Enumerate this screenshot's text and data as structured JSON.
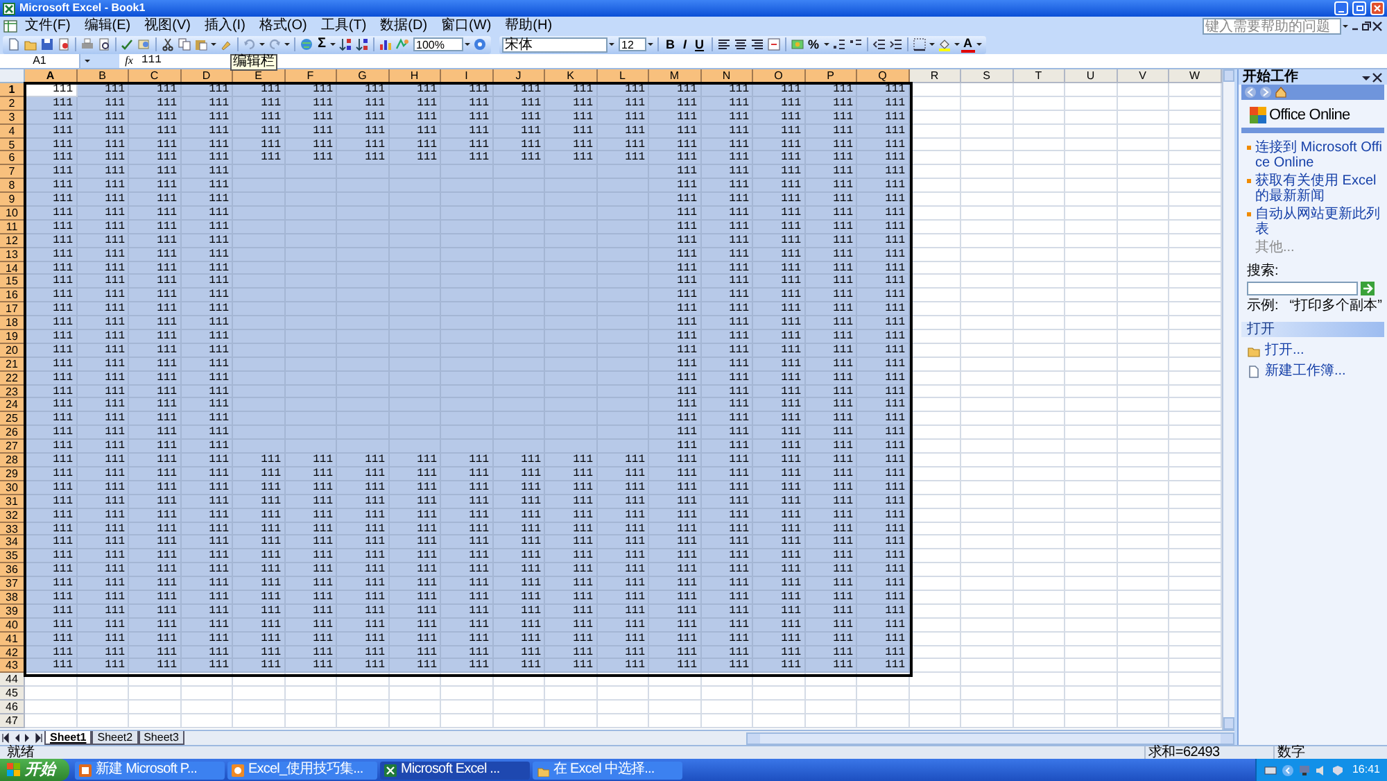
{
  "window": {
    "title": "Microsoft Excel - Book1"
  },
  "menu_bar": {
    "items": [
      "文件(F)",
      "编辑(E)",
      "视图(V)",
      "插入(I)",
      "格式(O)",
      "工具(T)",
      "数据(D)",
      "窗口(W)",
      "帮助(H)"
    ],
    "help_placeholder": "键入需要帮助的问题"
  },
  "toolbar": {
    "autosum": "Σ",
    "zoom": "100%",
    "font": "宋体",
    "font_size": "12",
    "bold": "B",
    "italic": "I",
    "underline": "U",
    "percent": "%",
    "font_color": "A"
  },
  "formula_bar": {
    "name_box": "A1",
    "fx": "fx",
    "value": "111"
  },
  "tooltip": "编辑栏",
  "columns": [
    {
      "label": "A",
      "selected": true,
      "active": true
    },
    {
      "label": "B",
      "selected": true,
      "active": false
    },
    {
      "label": "C",
      "selected": true,
      "active": false
    },
    {
      "label": "D",
      "selected": true,
      "active": false
    },
    {
      "label": "E",
      "selected": true,
      "active": false
    },
    {
      "label": "F",
      "selected": true,
      "active": false
    },
    {
      "label": "G",
      "selected": true,
      "active": false
    },
    {
      "label": "H",
      "selected": true,
      "active": false
    },
    {
      "label": "I",
      "selected": true,
      "active": false
    },
    {
      "label": "J",
      "selected": true,
      "active": false
    },
    {
      "label": "K",
      "selected": true,
      "active": false
    },
    {
      "label": "L",
      "selected": true,
      "active": false
    },
    {
      "label": "M",
      "selected": true,
      "active": false
    },
    {
      "label": "N",
      "selected": true,
      "active": false
    },
    {
      "label": "O",
      "selected": true,
      "active": false
    },
    {
      "label": "P",
      "selected": true,
      "active": false
    },
    {
      "label": "Q",
      "selected": true,
      "active": false
    },
    {
      "label": "R",
      "selected": false,
      "active": false
    },
    {
      "label": "S",
      "selected": false,
      "active": false
    },
    {
      "label": "T",
      "selected": false,
      "active": false
    },
    {
      "label": "U",
      "selected": false,
      "active": false
    },
    {
      "label": "V",
      "selected": false,
      "active": false
    },
    {
      "label": "W",
      "selected": false,
      "active": false
    }
  ],
  "rows": [
    {
      "label": "1",
      "selected": true,
      "active": true,
      "cells": {
        "A": "111",
        "B": "111",
        "C": "111",
        "D": "111",
        "E": "111",
        "F": "111",
        "G": "111",
        "H": "111",
        "I": "111",
        "J": "111",
        "K": "111",
        "L": "111",
        "M": "111",
        "N": "111",
        "O": "111",
        "P": "111",
        "Q": "111"
      }
    },
    {
      "label": "2",
      "selected": true,
      "active": false,
      "cells": {
        "A": "111",
        "B": "111",
        "C": "111",
        "D": "111",
        "E": "111",
        "F": "111",
        "G": "111",
        "H": "111",
        "I": "111",
        "J": "111",
        "K": "111",
        "L": "111",
        "M": "111",
        "N": "111",
        "O": "111",
        "P": "111",
        "Q": "111"
      }
    },
    {
      "label": "3",
      "selected": true,
      "active": false,
      "cells": {
        "A": "111",
        "B": "111",
        "C": "111",
        "D": "111",
        "E": "111",
        "F": "111",
        "G": "111",
        "H": "111",
        "I": "111",
        "J": "111",
        "K": "111",
        "L": "111",
        "M": "111",
        "N": "111",
        "O": "111",
        "P": "111",
        "Q": "111"
      }
    },
    {
      "label": "4",
      "selected": true,
      "active": false,
      "cells": {
        "A": "111",
        "B": "111",
        "C": "111",
        "D": "111",
        "E": "111",
        "F": "111",
        "G": "111",
        "H": "111",
        "I": "111",
        "J": "111",
        "K": "111",
        "L": "111",
        "M": "111",
        "N": "111",
        "O": "111",
        "P": "111",
        "Q": "111"
      }
    },
    {
      "label": "5",
      "selected": true,
      "active": false,
      "cells": {
        "A": "111",
        "B": "111",
        "C": "111",
        "D": "111",
        "E": "111",
        "F": "111",
        "G": "111",
        "H": "111",
        "I": "111",
        "J": "111",
        "K": "111",
        "L": "111",
        "M": "111",
        "N": "111",
        "O": "111",
        "P": "111",
        "Q": "111"
      }
    },
    {
      "label": "6",
      "selected": true,
      "active": false,
      "cells": {
        "A": "111",
        "B": "111",
        "C": "111",
        "D": "111",
        "E": "111",
        "F": "111",
        "G": "111",
        "H": "111",
        "I": "111",
        "J": "111",
        "K": "111",
        "L": "111",
        "M": "111",
        "N": "111",
        "O": "111",
        "P": "111",
        "Q": "111"
      }
    },
    {
      "label": "7",
      "selected": true,
      "active": false,
      "cells": {
        "A": "111",
        "B": "111",
        "C": "111",
        "D": "111",
        "M": "111",
        "N": "111",
        "O": "111",
        "P": "111",
        "Q": "111"
      }
    },
    {
      "label": "8",
      "selected": true,
      "active": false,
      "cells": {
        "A": "111",
        "B": "111",
        "C": "111",
        "D": "111",
        "M": "111",
        "N": "111",
        "O": "111",
        "P": "111",
        "Q": "111"
      }
    },
    {
      "label": "9",
      "selected": true,
      "active": false,
      "cells": {
        "A": "111",
        "B": "111",
        "C": "111",
        "D": "111",
        "M": "111",
        "N": "111",
        "O": "111",
        "P": "111",
        "Q": "111"
      }
    },
    {
      "label": "10",
      "selected": true,
      "active": false,
      "cells": {
        "A": "111",
        "B": "111",
        "C": "111",
        "D": "111",
        "M": "111",
        "N": "111",
        "O": "111",
        "P": "111",
        "Q": "111"
      }
    },
    {
      "label": "11",
      "selected": true,
      "active": false,
      "cells": {
        "A": "111",
        "B": "111",
        "C": "111",
        "D": "111",
        "M": "111",
        "N": "111",
        "O": "111",
        "P": "111",
        "Q": "111"
      }
    },
    {
      "label": "12",
      "selected": true,
      "active": false,
      "cells": {
        "A": "111",
        "B": "111",
        "C": "111",
        "D": "111",
        "M": "111",
        "N": "111",
        "O": "111",
        "P": "111",
        "Q": "111"
      }
    },
    {
      "label": "13",
      "selected": true,
      "active": false,
      "cells": {
        "A": "111",
        "B": "111",
        "C": "111",
        "D": "111",
        "M": "111",
        "N": "111",
        "O": "111",
        "P": "111",
        "Q": "111"
      }
    },
    {
      "label": "14",
      "selected": true,
      "active": false,
      "cells": {
        "A": "111",
        "B": "111",
        "C": "111",
        "D": "111",
        "M": "111",
        "N": "111",
        "O": "111",
        "P": "111",
        "Q": "111"
      }
    },
    {
      "label": "15",
      "selected": true,
      "active": false,
      "cells": {
        "A": "111",
        "B": "111",
        "C": "111",
        "D": "111",
        "M": "111",
        "N": "111",
        "O": "111",
        "P": "111",
        "Q": "111"
      }
    },
    {
      "label": "16",
      "selected": true,
      "active": false,
      "cells": {
        "A": "111",
        "B": "111",
        "C": "111",
        "D": "111",
        "M": "111",
        "N": "111",
        "O": "111",
        "P": "111",
        "Q": "111"
      }
    },
    {
      "label": "17",
      "selected": true,
      "active": false,
      "cells": {
        "A": "111",
        "B": "111",
        "C": "111",
        "D": "111",
        "M": "111",
        "N": "111",
        "O": "111",
        "P": "111",
        "Q": "111"
      }
    },
    {
      "label": "18",
      "selected": true,
      "active": false,
      "cells": {
        "A": "111",
        "B": "111",
        "C": "111",
        "D": "111",
        "M": "111",
        "N": "111",
        "O": "111",
        "P": "111",
        "Q": "111"
      }
    },
    {
      "label": "19",
      "selected": true,
      "active": false,
      "cells": {
        "A": "111",
        "B": "111",
        "C": "111",
        "D": "111",
        "M": "111",
        "N": "111",
        "O": "111",
        "P": "111",
        "Q": "111"
      }
    },
    {
      "label": "20",
      "selected": true,
      "active": false,
      "cells": {
        "A": "111",
        "B": "111",
        "C": "111",
        "D": "111",
        "M": "111",
        "N": "111",
        "O": "111",
        "P": "111",
        "Q": "111"
      }
    },
    {
      "label": "21",
      "selected": true,
      "active": false,
      "cells": {
        "A": "111",
        "B": "111",
        "C": "111",
        "D": "111",
        "M": "111",
        "N": "111",
        "O": "111",
        "P": "111",
        "Q": "111"
      }
    },
    {
      "label": "22",
      "selected": true,
      "active": false,
      "cells": {
        "A": "111",
        "B": "111",
        "C": "111",
        "D": "111",
        "M": "111",
        "N": "111",
        "O": "111",
        "P": "111",
        "Q": "111"
      }
    },
    {
      "label": "23",
      "selected": true,
      "active": false,
      "cells": {
        "A": "111",
        "B": "111",
        "C": "111",
        "D": "111",
        "M": "111",
        "N": "111",
        "O": "111",
        "P": "111",
        "Q": "111"
      }
    },
    {
      "label": "24",
      "selected": true,
      "active": false,
      "cells": {
        "A": "111",
        "B": "111",
        "C": "111",
        "D": "111",
        "M": "111",
        "N": "111",
        "O": "111",
        "P": "111",
        "Q": "111"
      }
    },
    {
      "label": "25",
      "selected": true,
      "active": false,
      "cells": {
        "A": "111",
        "B": "111",
        "C": "111",
        "D": "111",
        "M": "111",
        "N": "111",
        "O": "111",
        "P": "111",
        "Q": "111"
      }
    },
    {
      "label": "26",
      "selected": true,
      "active": false,
      "cells": {
        "A": "111",
        "B": "111",
        "C": "111",
        "D": "111",
        "M": "111",
        "N": "111",
        "O": "111",
        "P": "111",
        "Q": "111"
      }
    },
    {
      "label": "27",
      "selected": true,
      "active": false,
      "cells": {
        "A": "111",
        "B": "111",
        "C": "111",
        "D": "111",
        "M": "111",
        "N": "111",
        "O": "111",
        "P": "111",
        "Q": "111"
      }
    },
    {
      "label": "28",
      "selected": true,
      "active": false,
      "cells": {
        "A": "111",
        "B": "111",
        "C": "111",
        "D": "111",
        "E": "111",
        "F": "111",
        "G": "111",
        "H": "111",
        "I": "111",
        "J": "111",
        "K": "111",
        "L": "111",
        "M": "111",
        "N": "111",
        "O": "111",
        "P": "111",
        "Q": "111"
      }
    },
    {
      "label": "29",
      "selected": true,
      "active": false,
      "cells": {
        "A": "111",
        "B": "111",
        "C": "111",
        "D": "111",
        "E": "111",
        "F": "111",
        "G": "111",
        "H": "111",
        "I": "111",
        "J": "111",
        "K": "111",
        "L": "111",
        "M": "111",
        "N": "111",
        "O": "111",
        "P": "111",
        "Q": "111"
      }
    },
    {
      "label": "30",
      "selected": true,
      "active": false,
      "cells": {
        "A": "111",
        "B": "111",
        "C": "111",
        "D": "111",
        "E": "111",
        "F": "111",
        "G": "111",
        "H": "111",
        "I": "111",
        "J": "111",
        "K": "111",
        "L": "111",
        "M": "111",
        "N": "111",
        "O": "111",
        "P": "111",
        "Q": "111"
      }
    },
    {
      "label": "31",
      "selected": true,
      "active": false,
      "cells": {
        "A": "111",
        "B": "111",
        "C": "111",
        "D": "111",
        "E": "111",
        "F": "111",
        "G": "111",
        "H": "111",
        "I": "111",
        "J": "111",
        "K": "111",
        "L": "111",
        "M": "111",
        "N": "111",
        "O": "111",
        "P": "111",
        "Q": "111"
      }
    },
    {
      "label": "32",
      "selected": true,
      "active": false,
      "cells": {
        "A": "111",
        "B": "111",
        "C": "111",
        "D": "111",
        "E": "111",
        "F": "111",
        "G": "111",
        "H": "111",
        "I": "111",
        "J": "111",
        "K": "111",
        "L": "111",
        "M": "111",
        "N": "111",
        "O": "111",
        "P": "111",
        "Q": "111"
      }
    },
    {
      "label": "33",
      "selected": true,
      "active": false,
      "cells": {
        "A": "111",
        "B": "111",
        "C": "111",
        "D": "111",
        "E": "111",
        "F": "111",
        "G": "111",
        "H": "111",
        "I": "111",
        "J": "111",
        "K": "111",
        "L": "111",
        "M": "111",
        "N": "111",
        "O": "111",
        "P": "111",
        "Q": "111"
      }
    },
    {
      "label": "34",
      "selected": true,
      "active": false,
      "cells": {
        "A": "111",
        "B": "111",
        "C": "111",
        "D": "111",
        "E": "111",
        "F": "111",
        "G": "111",
        "H": "111",
        "I": "111",
        "J": "111",
        "K": "111",
        "L": "111",
        "M": "111",
        "N": "111",
        "O": "111",
        "P": "111",
        "Q": "111"
      }
    },
    {
      "label": "35",
      "selected": true,
      "active": false,
      "cells": {
        "A": "111",
        "B": "111",
        "C": "111",
        "D": "111",
        "E": "111",
        "F": "111",
        "G": "111",
        "H": "111",
        "I": "111",
        "J": "111",
        "K": "111",
        "L": "111",
        "M": "111",
        "N": "111",
        "O": "111",
        "P": "111",
        "Q": "111"
      }
    },
    {
      "label": "36",
      "selected": true,
      "active": false,
      "cells": {
        "A": "111",
        "B": "111",
        "C": "111",
        "D": "111",
        "E": "111",
        "F": "111",
        "G": "111",
        "H": "111",
        "I": "111",
        "J": "111",
        "K": "111",
        "L": "111",
        "M": "111",
        "N": "111",
        "O": "111",
        "P": "111",
        "Q": "111"
      }
    },
    {
      "label": "37",
      "selected": true,
      "active": false,
      "cells": {
        "A": "111",
        "B": "111",
        "C": "111",
        "D": "111",
        "E": "111",
        "F": "111",
        "G": "111",
        "H": "111",
        "I": "111",
        "J": "111",
        "K": "111",
        "L": "111",
        "M": "111",
        "N": "111",
        "O": "111",
        "P": "111",
        "Q": "111"
      }
    },
    {
      "label": "38",
      "selected": true,
      "active": false,
      "cells": {
        "A": "111",
        "B": "111",
        "C": "111",
        "D": "111",
        "E": "111",
        "F": "111",
        "G": "111",
        "H": "111",
        "I": "111",
        "J": "111",
        "K": "111",
        "L": "111",
        "M": "111",
        "N": "111",
        "O": "111",
        "P": "111",
        "Q": "111"
      }
    },
    {
      "label": "39",
      "selected": true,
      "active": false,
      "cells": {
        "A": "111",
        "B": "111",
        "C": "111",
        "D": "111",
        "E": "111",
        "F": "111",
        "G": "111",
        "H": "111",
        "I": "111",
        "J": "111",
        "K": "111",
        "L": "111",
        "M": "111",
        "N": "111",
        "O": "111",
        "P": "111",
        "Q": "111"
      }
    },
    {
      "label": "40",
      "selected": true,
      "active": false,
      "cells": {
        "A": "111",
        "B": "111",
        "C": "111",
        "D": "111",
        "E": "111",
        "F": "111",
        "G": "111",
        "H": "111",
        "I": "111",
        "J": "111",
        "K": "111",
        "L": "111",
        "M": "111",
        "N": "111",
        "O": "111",
        "P": "111",
        "Q": "111"
      }
    },
    {
      "label": "41",
      "selected": true,
      "active": false,
      "cells": {
        "A": "111",
        "B": "111",
        "C": "111",
        "D": "111",
        "E": "111",
        "F": "111",
        "G": "111",
        "H": "111",
        "I": "111",
        "J": "111",
        "K": "111",
        "L": "111",
        "M": "111",
        "N": "111",
        "O": "111",
        "P": "111",
        "Q": "111"
      }
    },
    {
      "label": "42",
      "selected": true,
      "active": false,
      "cells": {
        "A": "111",
        "B": "111",
        "C": "111",
        "D": "111",
        "E": "111",
        "F": "111",
        "G": "111",
        "H": "111",
        "I": "111",
        "J": "111",
        "K": "111",
        "L": "111",
        "M": "111",
        "N": "111",
        "O": "111",
        "P": "111",
        "Q": "111"
      }
    },
    {
      "label": "43",
      "selected": true,
      "active": false,
      "cells": {
        "A": "111",
        "B": "111",
        "C": "111",
        "D": "111",
        "E": "111",
        "F": "111",
        "G": "111",
        "H": "111",
        "I": "111",
        "J": "111",
        "K": "111",
        "L": "111",
        "M": "111",
        "N": "111",
        "O": "111",
        "P": "111",
        "Q": "111"
      }
    },
    {
      "label": "44",
      "selected": false,
      "active": false
    },
    {
      "label": "45",
      "selected": false,
      "active": false
    },
    {
      "label": "46",
      "selected": false,
      "active": false
    },
    {
      "label": "47",
      "selected": false,
      "active": false
    }
  ],
  "sheet_tabs": [
    {
      "label": "Sheet1",
      "selected": true
    },
    {
      "label": "Sheet2",
      "selected": false
    },
    {
      "label": "Sheet3",
      "selected": false
    }
  ],
  "task_pane": {
    "title": "开始工作",
    "logo": "Office Online",
    "links": [
      "连接到 Microsoft Office Online",
      "获取有关使用 Excel 的最新新闻",
      "自动从网站更新此列表"
    ],
    "more": "其他...",
    "search_label": "搜索:",
    "example_label": "示例:",
    "example": "“打印多个副本”",
    "open_section": {
      "title": "打开",
      "items": [
        {
          "label": "打开...",
          "kind": "folder"
        },
        {
          "label": "新建工作簿...",
          "kind": "document"
        }
      ]
    }
  },
  "status_bar": {
    "status": "就绪",
    "sum": "求和=62493",
    "mode": "数字"
  },
  "taskbar": {
    "start": "开始",
    "tasks": [
      {
        "label": "新建 Microsoft P...",
        "kind": "presentation",
        "selected": false
      },
      {
        "label": "Excel_使用技巧集...",
        "kind": "browser",
        "selected": false
      },
      {
        "label": "Microsoft Excel ...",
        "kind": "spreadsheet",
        "selected": true
      },
      {
        "label": "在 Excel 中选择...",
        "kind": "folder",
        "selected": false
      }
    ],
    "clock": "16:41"
  }
}
